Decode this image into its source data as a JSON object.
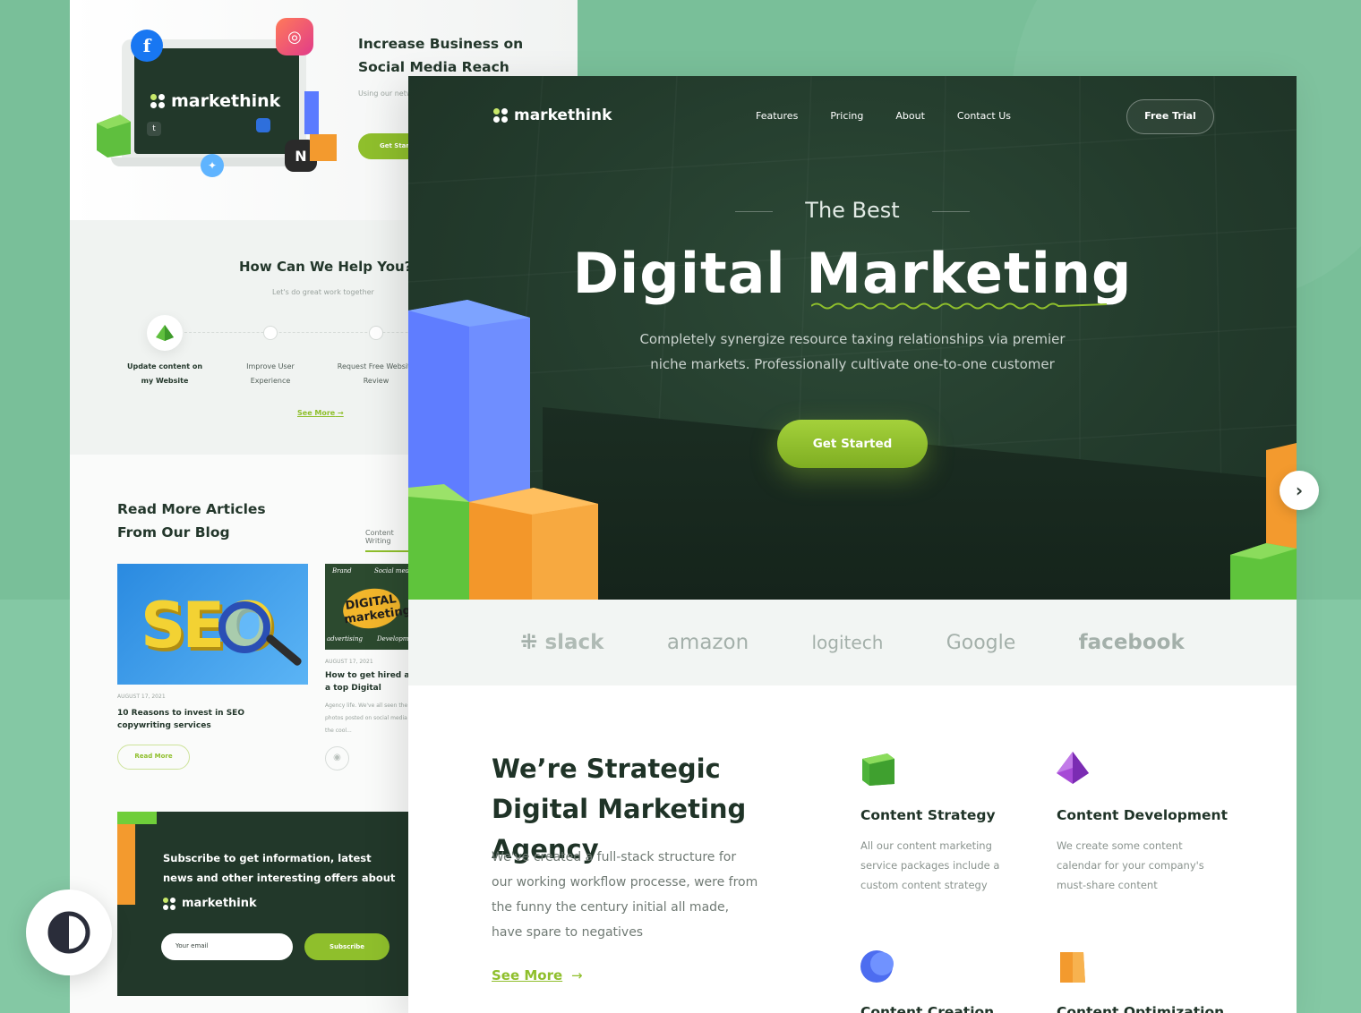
{
  "colors": {
    "brand_dark": "#22382a",
    "accent": "#8fbf2c",
    "background": "#79bf99"
  },
  "brand": {
    "name": "markethink"
  },
  "back_page": {
    "hero": {
      "title": "Increase Business on Social Media Reach",
      "text": "Using our network we help promote",
      "button": "Get Started"
    },
    "help": {
      "title": "How Can We Help You?",
      "subtitle": "Let's do great work together",
      "steps": [
        {
          "label": "Update content on my Website"
        },
        {
          "label": "Improve User Experience"
        },
        {
          "label": "Request Free Website Review"
        }
      ],
      "see_more": "See More"
    },
    "blog": {
      "title": "Read More Articles From Our Blog",
      "tab": "Content Writing",
      "posts": [
        {
          "image_text": "SEO",
          "date": "AUGUST 17, 2021",
          "title": "10 Reasons to invest in SEO copywriting services",
          "button": "Read More"
        },
        {
          "image_text": "DIGITAL marketing",
          "date": "AUGUST 17, 2021",
          "title": "How to get hired at a top Digital Marketing",
          "text": "Agency life. We've all seen the photos posted on social media the cool..."
        }
      ]
    },
    "subscribe": {
      "text": "Subscribe to get information, latest news and other interesting offers about",
      "email_placeholder": "Your email",
      "button": "Subscribe"
    }
  },
  "front_page": {
    "nav": {
      "items": [
        "Features",
        "Pricing",
        "About",
        "Contact Us"
      ],
      "cta": "Free Trial"
    },
    "hero": {
      "eyebrow": "The Best",
      "headline": "Digital Marketing",
      "lede": "Completely synergize resource taxing relationships via premier niche markets. Professionally cultivate one-to-one customer",
      "button": "Get Started"
    },
    "brands": [
      "slack",
      "amazon",
      "logitech",
      "Google",
      "facebook"
    ],
    "about": {
      "title": "We’re Strategic Digital Marketing Agency",
      "text": "We've created a full-stack structure for our working workflow processe, were from the funny the century initial all made, have spare to negatives",
      "link": "See More"
    },
    "services": [
      {
        "icon": "green-cube-icon",
        "title": "Content Strategy",
        "text": "All our content marketing service packages include a custom content strategy"
      },
      {
        "icon": "purple-pyramid-icon",
        "title": "Content Development",
        "text": "We create some content calendar for your company's must-share content"
      },
      {
        "icon": "blue-sphere-icon",
        "title": "Content Creation",
        "text": ""
      },
      {
        "icon": "orange-prism-icon",
        "title": "Content Optimization",
        "text": ""
      }
    ]
  },
  "controls": {
    "next_icon": "chevron-right-icon",
    "theme_icon": "contrast-icon"
  }
}
